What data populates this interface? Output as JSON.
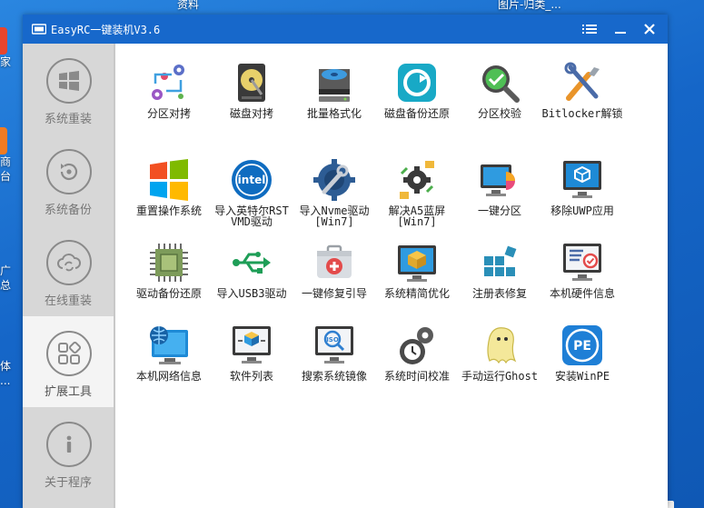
{
  "desktop": {
    "top_labels": [
      "资料",
      "图片-归类_..."
    ],
    "left_labels": [
      "家",
      "商\n台",
      "广\n总",
      "体\n..."
    ]
  },
  "window": {
    "title": "EasyRC一键装机V3.6",
    "menu_icon": "menu-icon",
    "minimize_icon": "minimize-icon",
    "close_icon": "close-icon"
  },
  "sidebar": {
    "items": [
      {
        "label": "系统重装",
        "icon": "windows-logo-icon"
      },
      {
        "label": "系统备份",
        "icon": "backup-icon"
      },
      {
        "label": "在线重装",
        "icon": "cloud-sync-icon"
      },
      {
        "label": "扩展工具",
        "icon": "apps-grid-icon",
        "active": true
      },
      {
        "label": "关于程序",
        "icon": "info-icon"
      }
    ]
  },
  "tools": [
    {
      "label": "分区对拷",
      "icon": "partition-copy-icon"
    },
    {
      "label": "磁盘对拷",
      "icon": "disk-copy-icon"
    },
    {
      "label": "批量格式化",
      "icon": "batch-format-icon"
    },
    {
      "label": "磁盘备份还原",
      "icon": "disk-backup-restore-icon"
    },
    {
      "label": "分区校验",
      "icon": "partition-check-icon"
    },
    {
      "label": "Bitlocker解锁",
      "icon": "bitlocker-unlock-icon"
    },
    {
      "label": "重置操作系统",
      "icon": "windows-reset-icon"
    },
    {
      "label": "导入英特尔RST\nVMD驱动",
      "icon": "intel-icon"
    },
    {
      "label": "导入Nvme驱动\n[Win7]",
      "icon": "nvme-driver-icon"
    },
    {
      "label": "解决A5蓝屏\n[Win7]",
      "icon": "bluescreen-fix-icon"
    },
    {
      "label": "一键分区",
      "icon": "one-click-partition-icon"
    },
    {
      "label": "移除UWP应用",
      "icon": "remove-uwp-icon"
    },
    {
      "label": "驱动备份还原",
      "icon": "driver-backup-icon"
    },
    {
      "label": "导入USB3驱动",
      "icon": "usb-icon"
    },
    {
      "label": "一键修复引导",
      "icon": "repair-boot-icon"
    },
    {
      "label": "系统精简优化",
      "icon": "system-optimize-icon"
    },
    {
      "label": "注册表修复",
      "icon": "registry-repair-icon"
    },
    {
      "label": "本机硬件信息",
      "icon": "hardware-info-icon"
    },
    {
      "label": "本机网络信息",
      "icon": "network-info-icon"
    },
    {
      "label": "软件列表",
      "icon": "software-list-icon"
    },
    {
      "label": "搜索系统镜像",
      "icon": "search-image-icon"
    },
    {
      "label": "系统时间校准",
      "icon": "time-calibrate-icon"
    },
    {
      "label": "手动运行Ghost",
      "icon": "ghost-icon"
    },
    {
      "label": "安装WinPE",
      "icon": "winpe-icon"
    }
  ]
}
